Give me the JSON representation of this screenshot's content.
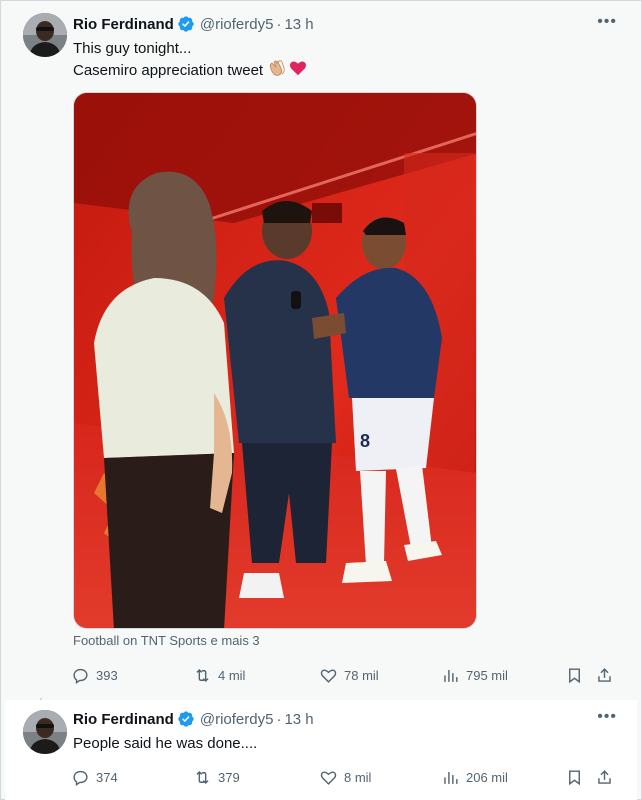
{
  "tweets": [
    {
      "author": {
        "name": "Rio Ferdinand",
        "handle": "@rioferdy5",
        "time": "13 h",
        "verified": true
      },
      "text_lines": [
        "This guy tonight...",
        "Casemiro appreciation tweet"
      ],
      "emojis": [
        "clapping-hands-emoji",
        "red-heart-emoji"
      ],
      "media_source": "Football on TNT Sports e mais 3",
      "stats": {
        "replies": "393",
        "reposts": "4 mil",
        "likes": "78 mil",
        "views": "795 mil"
      }
    },
    {
      "author": {
        "name": "Rio Ferdinand",
        "handle": "@rioferdy5",
        "time": "13 h",
        "verified": true
      },
      "text_lines": [
        "People said he was done...."
      ],
      "stats": {
        "replies": "374",
        "reposts": "379",
        "likes": "8 mil",
        "views": "206 mil"
      }
    }
  ],
  "separator": "·",
  "more_label": "•••",
  "colors": {
    "text": "#0f1419",
    "secondary": "#536471",
    "verified": "#1d9bf0",
    "border": "#cfd9de",
    "background": "#f7f9f9"
  }
}
